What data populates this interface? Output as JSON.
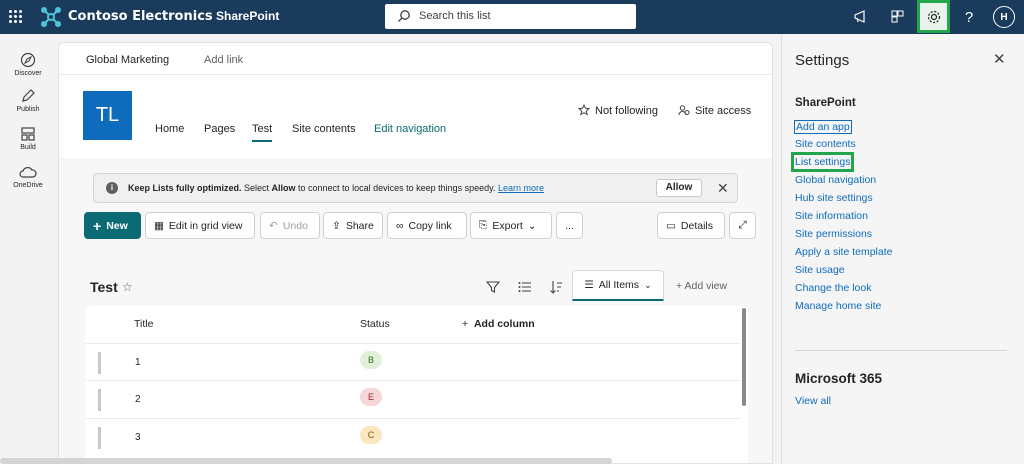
{
  "suite": {
    "brand": "Contoso Electronics",
    "app": "SharePoint",
    "search_placeholder": "Search this list",
    "avatar_initial": "H",
    "help": "?"
  },
  "rail": {
    "items": [
      {
        "label": "Discover",
        "icon": "compass-icon"
      },
      {
        "label": "Publish",
        "icon": "pen-icon"
      },
      {
        "label": "Build",
        "icon": "build-icon"
      },
      {
        "label": "OneDrive",
        "icon": "cloud-icon"
      }
    ]
  },
  "hub": {
    "title": "Global Marketing",
    "add_link": "Add link"
  },
  "site": {
    "logo_initials": "TL",
    "nav": [
      "Home",
      "Pages",
      "Test",
      "Site contents",
      "Edit navigation"
    ],
    "active_nav": "Test",
    "follow": "Not following",
    "access": "Site access"
  },
  "banner": {
    "bold": "Keep Lists fully optimized.",
    "text_before": " Select ",
    "allow_word": "Allow",
    "text_after": " to connect to local devices to keep things speedy. ",
    "link": "Learn more",
    "button": "Allow"
  },
  "commands": {
    "new": "New",
    "edit_grid": "Edit in grid view",
    "undo": "Undo",
    "share": "Share",
    "copy_link": "Copy link",
    "export": "Export",
    "more": "...",
    "details": "Details"
  },
  "list": {
    "title": "Test",
    "view": "All Items",
    "add_view": "Add view",
    "columns": [
      "Title",
      "Status",
      "Add column"
    ],
    "rows": [
      {
        "title": "1",
        "status": "B",
        "color": "#dff2d8"
      },
      {
        "title": "2",
        "status": "E",
        "color": "#f6d6d6"
      },
      {
        "title": "3",
        "status": "C",
        "color": "#fbe7bf"
      }
    ]
  },
  "settings": {
    "title": "Settings",
    "section": "SharePoint",
    "links": [
      "Add an app",
      "Site contents",
      "List settings",
      "Global navigation",
      "Hub site settings",
      "Site information",
      "Site permissions",
      "Apply a site template",
      "Site usage",
      "Change the look",
      "Manage home site"
    ],
    "m365": "Microsoft 365",
    "view_all": "View all"
  },
  "colors": {
    "suite": "#1b3b5c",
    "accent": "#0b6a73",
    "link": "#0f6cbd",
    "highlight": "#22a54b"
  }
}
